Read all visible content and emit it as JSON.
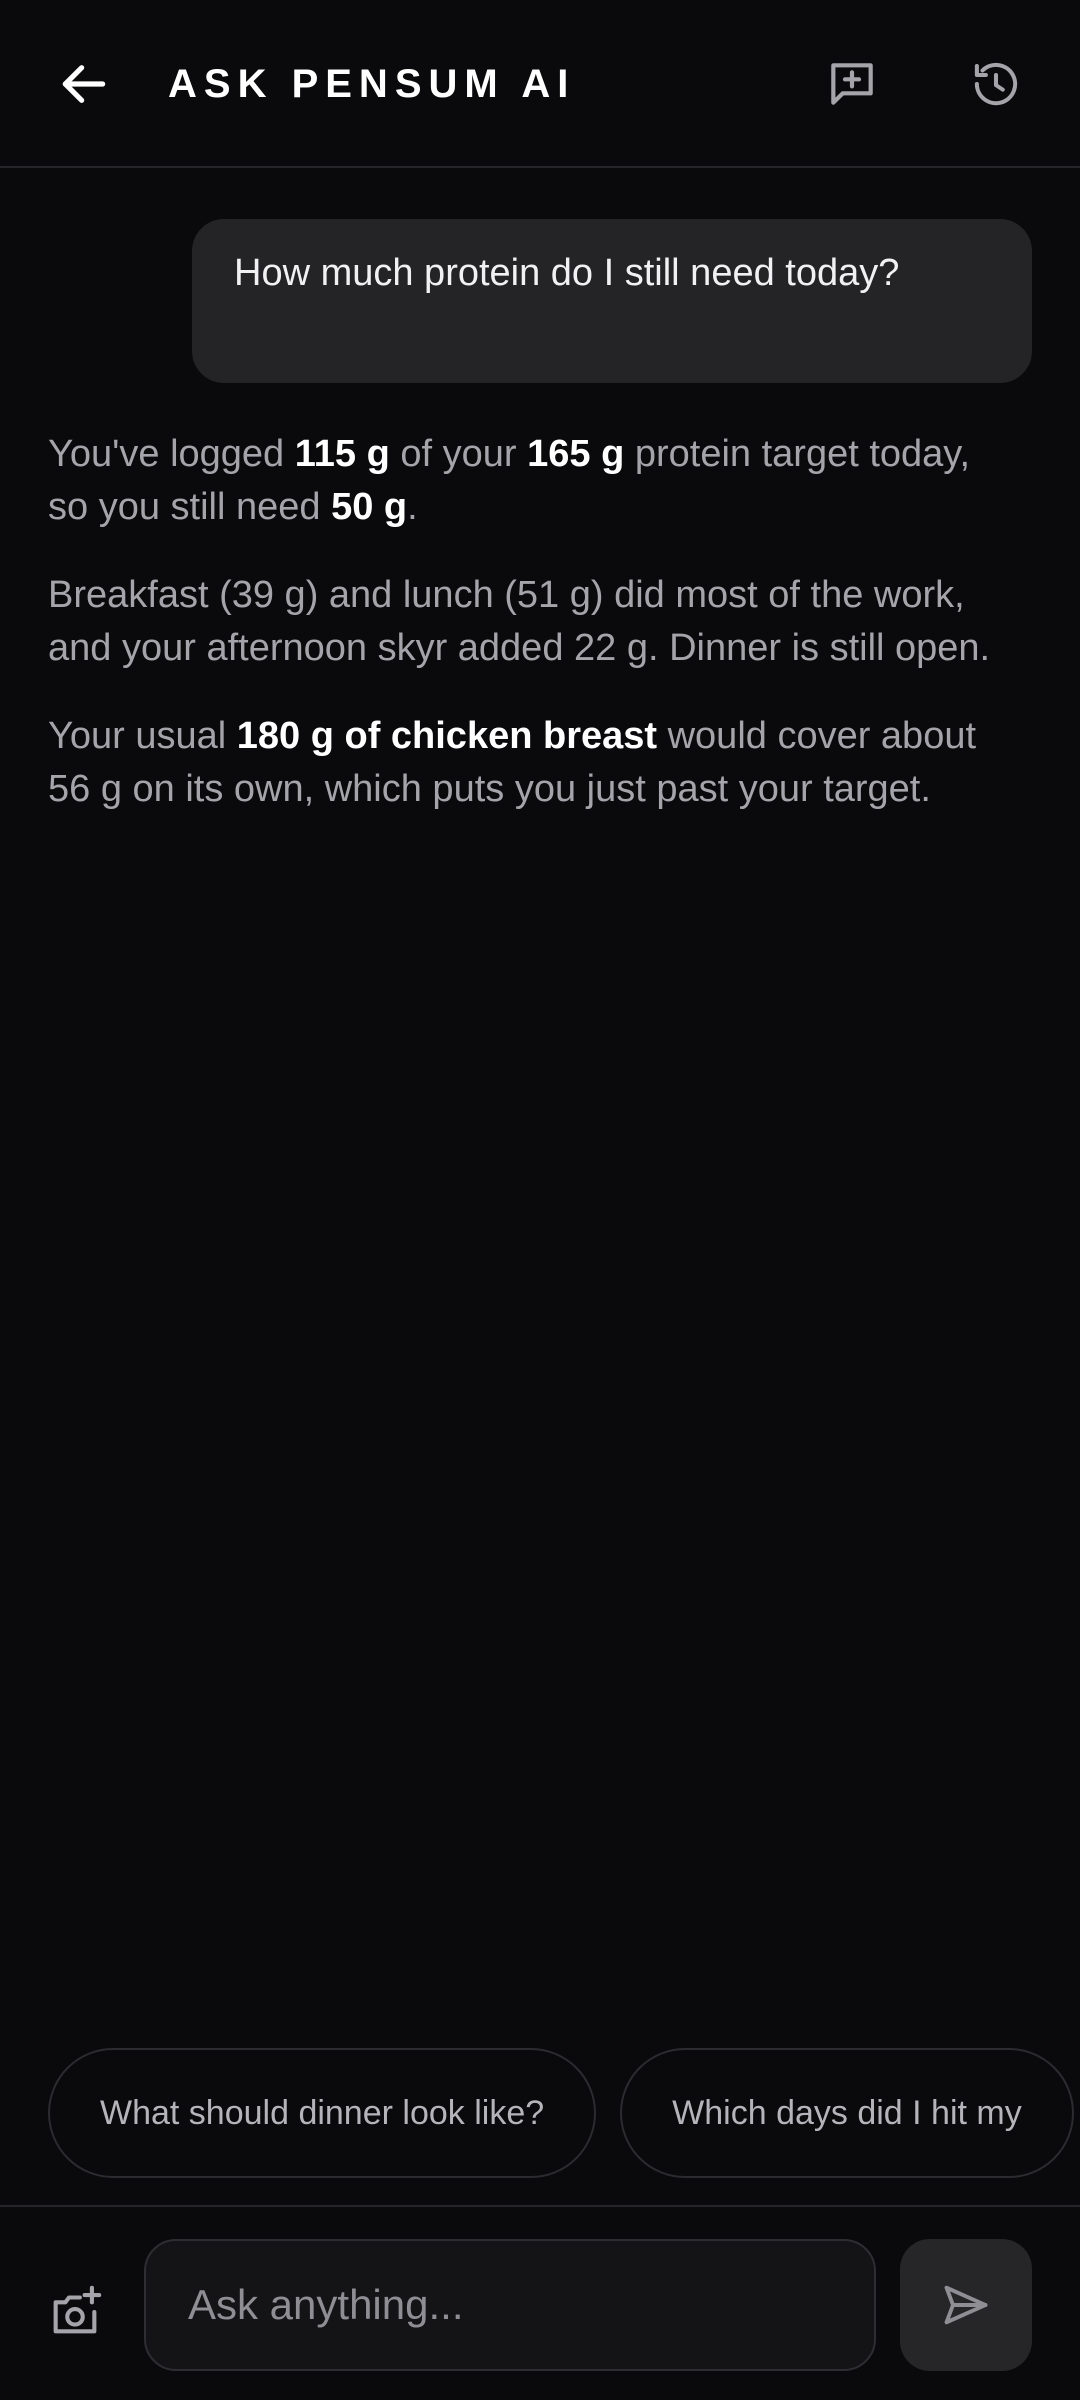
{
  "header": {
    "title": "ASK PENSUM AI",
    "back_icon": "arrow-left-icon",
    "new_chat_icon": "new-chat-icon",
    "history_icon": "history-icon"
  },
  "conversation": {
    "user_message": "How much protein do I still need today?",
    "answer": {
      "p1": {
        "t1": "You've logged ",
        "b1": "115 g",
        "t2": " of your ",
        "b2": "165 g",
        "t3": " protein target today, so you still need ",
        "b3": "50 g",
        "t4": "."
      },
      "p2": "Breakfast (39 g) and lunch (51 g) did most of the work, and your afternoon skyr added 22 g. Dinner is still open.",
      "p3": {
        "t1": "Your usual ",
        "b1": "180 g of chicken breast",
        "t2": " would cover about 56 g on its own, which puts you just past your target."
      }
    }
  },
  "suggestions": [
    "What should dinner look like?",
    "Which days did I hit my"
  ],
  "composer": {
    "placeholder": "Ask anything...",
    "camera_icon": "add-photo-icon",
    "send_icon": "send-icon"
  },
  "colors": {
    "background": "#0a0a0c",
    "bubble": "#242427",
    "text_muted": "#a4a4aa",
    "text_strong": "#ffffff"
  }
}
